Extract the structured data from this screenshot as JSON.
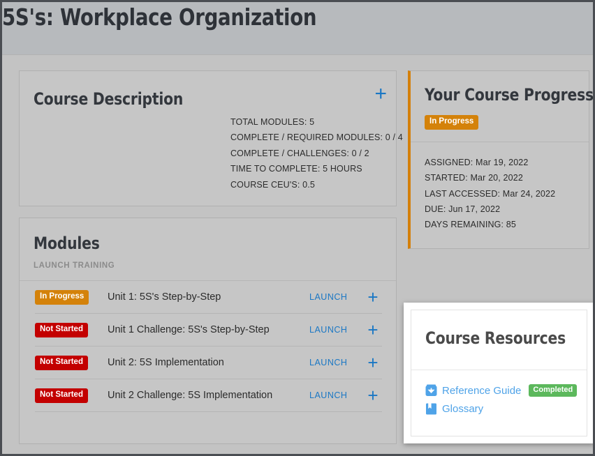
{
  "header": {
    "title": "5S's: Workplace Organization"
  },
  "colors": {
    "accent_orange": "#d4820a",
    "danger_red": "#c30000",
    "success_green": "#5cb85c",
    "link_blue": "#1a77c4",
    "resource_link_blue": "#4fa3e8",
    "page_background": "#c3c3c3",
    "header_background": "#b7babd"
  },
  "course_description": {
    "title": "Course Description",
    "expand_icon": "plus-icon",
    "meta": [
      "TOTAL MODULES: 5",
      "COMPLETE / REQUIRED MODULES: 0 / 4",
      "COMPLETE / CHALLENGES: 0 / 2",
      "TIME TO COMPLETE: 5 HOURS",
      "COURSE CEU'S: 0.5"
    ]
  },
  "modules": {
    "title": "Modules",
    "subtitle": "LAUNCH TRAINING",
    "launch_label": "LAUNCH",
    "expand_icon": "plus-icon",
    "rows": [
      {
        "status": "In Progress",
        "status_kind": "inprogress",
        "name": "Unit 1: 5S's Step-by-Step",
        "launch": "LAUNCH"
      },
      {
        "status": "Not Started",
        "status_kind": "notstarted",
        "name": "Unit 1 Challenge: 5S's Step-by-Step",
        "launch": "LAUNCH"
      },
      {
        "status": "Not Started",
        "status_kind": "notstarted",
        "name": "Unit 2: 5S Implementation",
        "launch": "LAUNCH"
      },
      {
        "status": "Not Started",
        "status_kind": "notstarted",
        "name": "Unit 2 Challenge: 5S Implementation",
        "launch": "LAUNCH"
      }
    ]
  },
  "course_progress": {
    "title": "Your Course Progress",
    "status": "In Progress",
    "status_kind": "inprogress",
    "meta": [
      "ASSIGNED: Mar 19, 2022",
      "STARTED: Mar 20, 2022",
      "LAST ACCESSED: Mar 24, 2022",
      "DUE: Jun 17, 2022",
      "DAYS REMAINING: 85"
    ]
  },
  "course_resources": {
    "title": "Course Resources",
    "items": [
      {
        "label": "Reference Guide",
        "icon": "download-document-icon",
        "badge": "Completed",
        "badge_kind": "completed"
      },
      {
        "label": "Glossary",
        "icon": "bookmark-book-icon",
        "badge": null,
        "badge_kind": null
      }
    ]
  }
}
